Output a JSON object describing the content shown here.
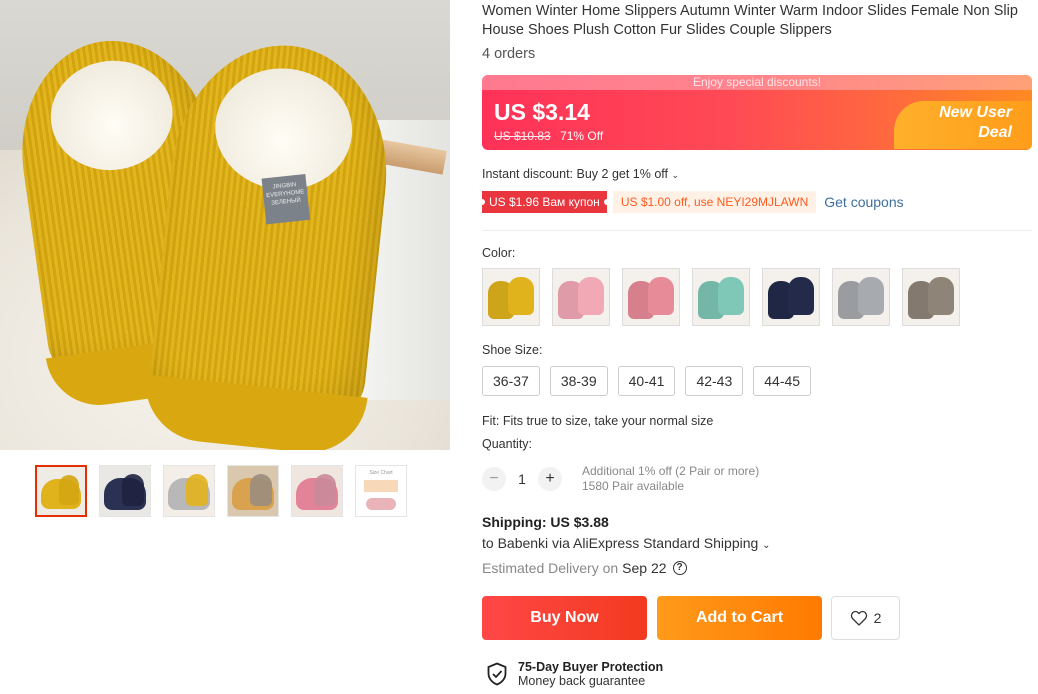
{
  "product": {
    "title": "Women Winter Home Slippers Autumn Winter Warm Indoor Slides Female Non Slip House Shoes Plush Cotton Fur Slides Couple Slippers",
    "orders": "4 orders"
  },
  "price_banner": {
    "top_text": "Enjoy special discounts!",
    "price": "US $3.14",
    "original_price": "US $10.83",
    "discount": "71% Off",
    "deal_text": "New User\nDeal"
  },
  "promos": {
    "instant_discount": "Instant discount: Buy 2 get 1% off",
    "coupon1": "US $1.96 Вам купон",
    "coupon2": "US $1.00 off, use NEYI29MJLAWN",
    "get_coupons": "Get coupons"
  },
  "color": {
    "label": "Color:",
    "options": [
      "yellow",
      "pink",
      "rose",
      "mint",
      "navy",
      "gray",
      "taupe"
    ],
    "swatches": [
      "#e0b21c",
      "#f2a9b6",
      "#e88b98",
      "#7fc7b6",
      "#232a4a",
      "#a7aaae",
      "#8e8478"
    ]
  },
  "size": {
    "label": "Shoe Size:",
    "options": [
      "36-37",
      "38-39",
      "40-41",
      "42-43",
      "44-45"
    ]
  },
  "fit": "Fit: Fits true to size, take your normal size",
  "quantity": {
    "label": "Quantity:",
    "minus": "−",
    "value": "1",
    "plus": "+",
    "info1": "Additional 1% off (2 Pair or more)",
    "info2": "1580 Pair available"
  },
  "shipping": {
    "cost": "Shipping: US $3.88",
    "to": "to Babenki via AliExpress Standard Shipping",
    "est_label": "Estimated Delivery on",
    "est_date": "Sep 22"
  },
  "actions": {
    "buy_now": "Buy Now",
    "add_to_cart": "Add to Cart",
    "wishlist_count": "2"
  },
  "protection": {
    "title": "75-Day Buyer Protection",
    "subtitle": "Money back guarantee"
  },
  "gallery": {
    "tag_text": "JINGBIN EVERYHOME ЗЕЛЕНЫЙ",
    "thumbs": [
      "#e0b21c",
      "#2b3152",
      "#b8b8b8",
      "#d9a24f",
      "#e3839a",
      "#ffffff"
    ],
    "size_chart_text": "Size Chart"
  },
  "colors": {
    "brand_red": "#ff4747",
    "brand_orange": "#ff9a1a",
    "link": "#3d6f9e"
  }
}
